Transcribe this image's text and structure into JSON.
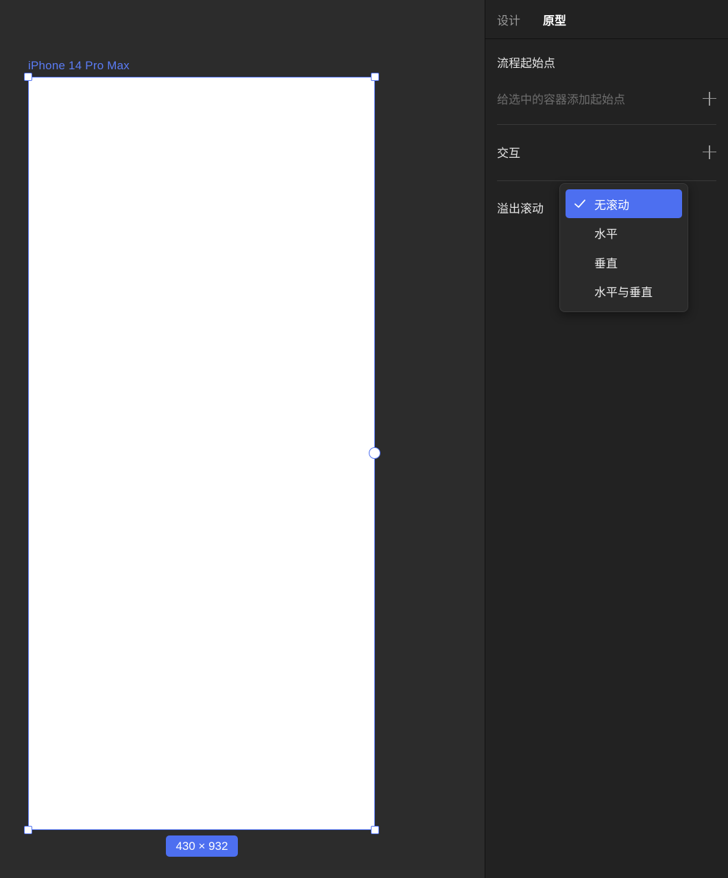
{
  "canvas": {
    "frame_label": "iPhone 14 Pro Max",
    "dimensions": "430 × 932",
    "accent": "#4d6ff0"
  },
  "panel": {
    "tabs": [
      {
        "label": "设计",
        "active": false
      },
      {
        "label": "原型",
        "active": true
      }
    ],
    "flow_start": {
      "title": "流程起始点",
      "hint": "给选中的容器添加起始点"
    },
    "interaction": {
      "title": "交互"
    },
    "overflow": {
      "title": "溢出滚动",
      "options": [
        {
          "label": "无滚动",
          "selected": true
        },
        {
          "label": "水平",
          "selected": false
        },
        {
          "label": "垂直",
          "selected": false
        },
        {
          "label": "水平与垂直",
          "selected": false
        }
      ]
    }
  }
}
